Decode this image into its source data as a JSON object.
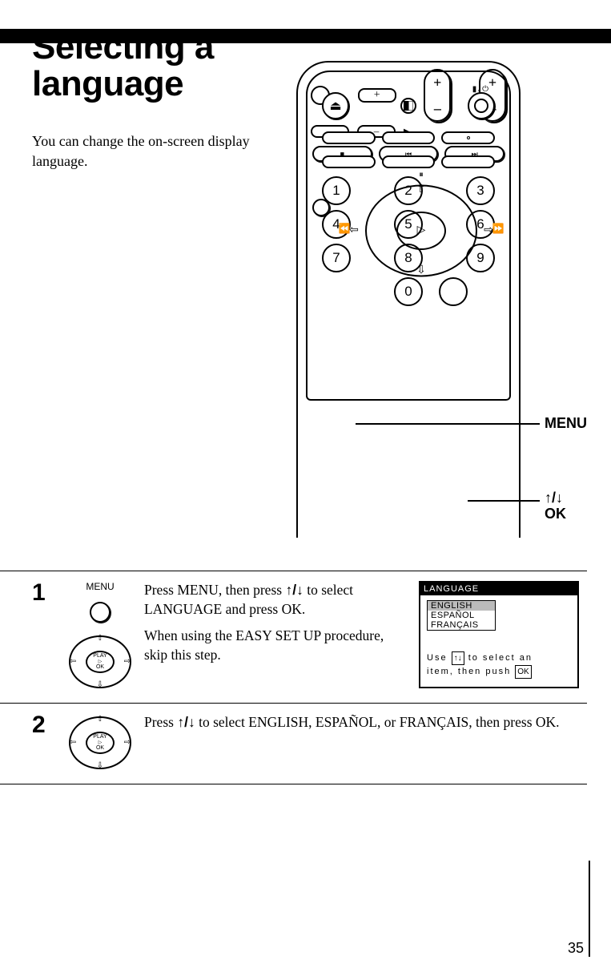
{
  "title_line1": "Selecting a",
  "title_line2": "language",
  "intro": "You can change the on-screen display language.",
  "callouts": {
    "menu": "MENU",
    "arrows_ok_line1": "↑/↓",
    "arrows_ok_line2": "OK"
  },
  "remote": {
    "keys_row1": [
      "1",
      "2",
      "3"
    ],
    "keys_row2": [
      "4",
      "5",
      "6"
    ],
    "keys_row3": [
      "7",
      "8",
      "9"
    ],
    "keys_row4_center": "0",
    "dpad_center": "▷",
    "dpad_small_label1": "PLAY",
    "dpad_small_label2": "OK",
    "eject": "⏏"
  },
  "steps": {
    "s1": {
      "num": "1",
      "menu_label": "MENU",
      "text1_a": "Press MENU, then press ",
      "text1_b": " to select LANGUAGE and press OK.",
      "text2": "When using the EASY SET UP procedure, skip this step.",
      "arrow_sym": "↑/↓"
    },
    "s2": {
      "num": "2",
      "text_a": "Press ",
      "text_b": " to select ENGLISH, ESPAÑOL, or FRANÇAIS, then press OK.",
      "arrow_sym": "↑/↓"
    }
  },
  "osd": {
    "header": "LANGUAGE",
    "items": [
      "ENGLISH",
      "ESPAÑOL",
      "FRANÇAIS"
    ],
    "hint_line1_a": "Use",
    "hint_line1_b": "↑↓",
    "hint_line1_c": "to select an",
    "hint_line2_a": "item, then push",
    "hint_line2_b": "OK"
  },
  "page_number": "35"
}
